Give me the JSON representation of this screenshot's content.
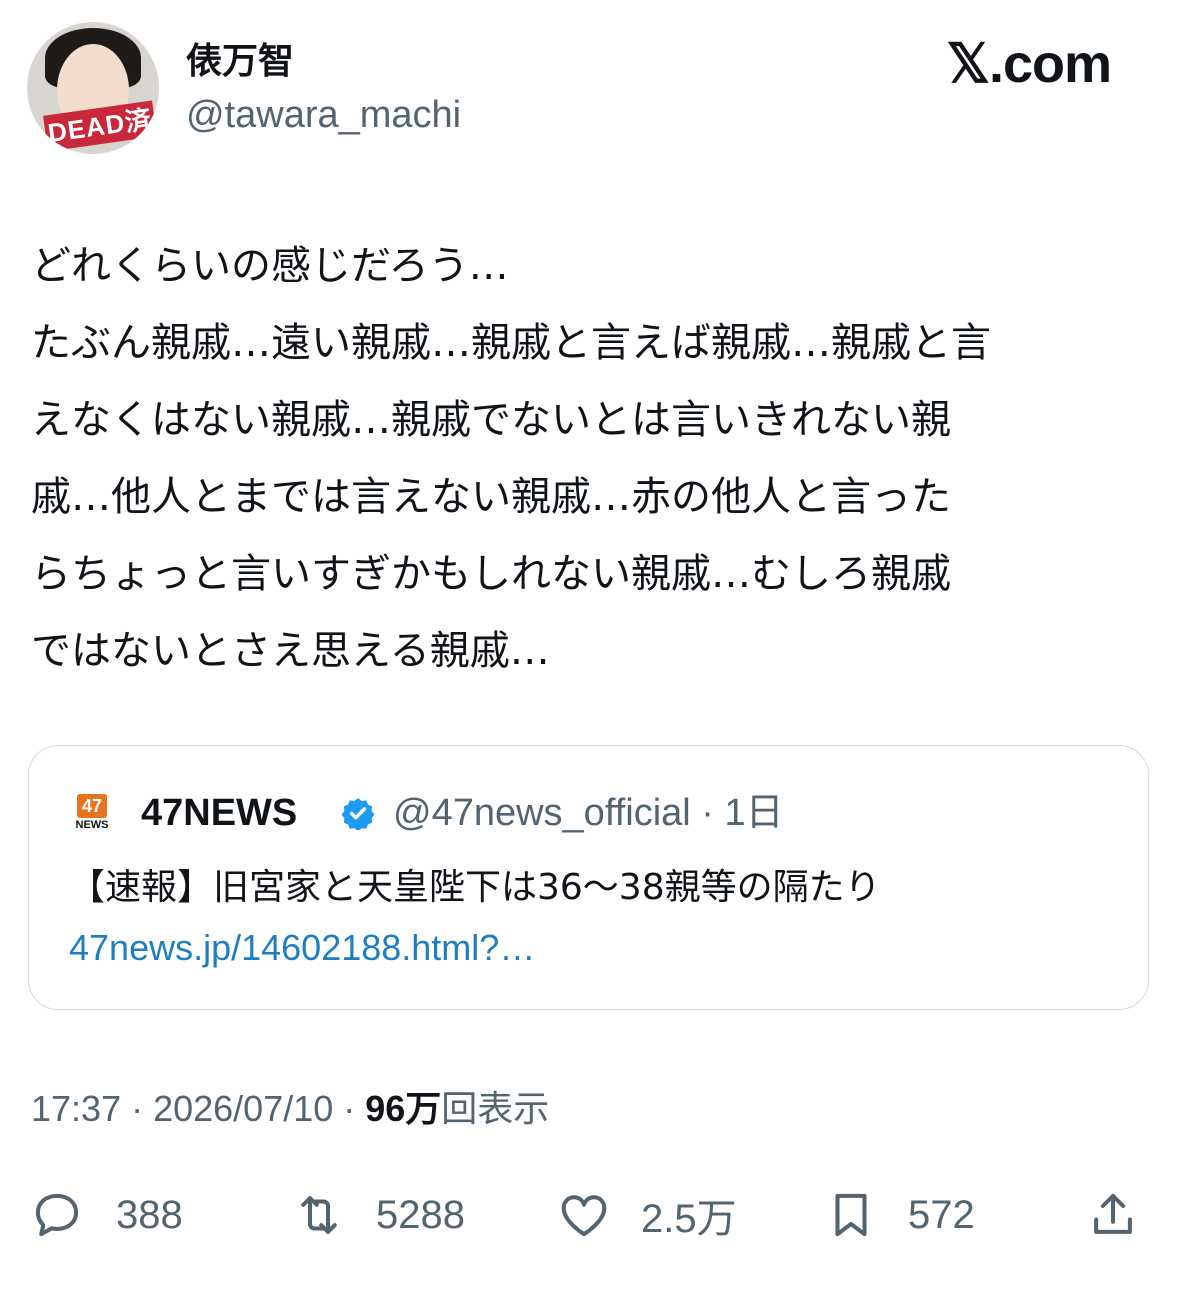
{
  "author": {
    "display_name": "俵万智",
    "handle": "@tawara_machi",
    "avatar_stamp": "DEAD済"
  },
  "site_logo": "𝕏.com",
  "tweet": {
    "text": "どれくらいの感じだろう…\nたぶん親戚…遠い親戚…親戚と言えば親戚…親戚と言\nえなくはない親戚…親戚でないとは言いきれない親\n戚…他人とまでは言えない親戚…赤の他人と言った\nらちょっと言いすぎかもしれない親戚…むしろ親戚\nではないとさえ思える親戚…"
  },
  "quote": {
    "logo_top": "47",
    "logo_bottom": "NEWS",
    "name": "47NEWS",
    "handle_time": "@47news_official · 1日",
    "text": "【速報】旧宮家と天皇陛下は36〜38親等の隔たり",
    "link": "47news.jp/14602188.html?…"
  },
  "meta": {
    "time_date": "17:37 · 2026/07/10 · ",
    "views_count": "96万",
    "views_label": "回表示"
  },
  "actions": {
    "replies": "388",
    "reposts": "5288",
    "likes": "2.5万",
    "bookmarks": "572"
  },
  "colors": {
    "secondary_text": "#536471",
    "link": "#1d7fc1",
    "verified": "#1d9bf0"
  }
}
